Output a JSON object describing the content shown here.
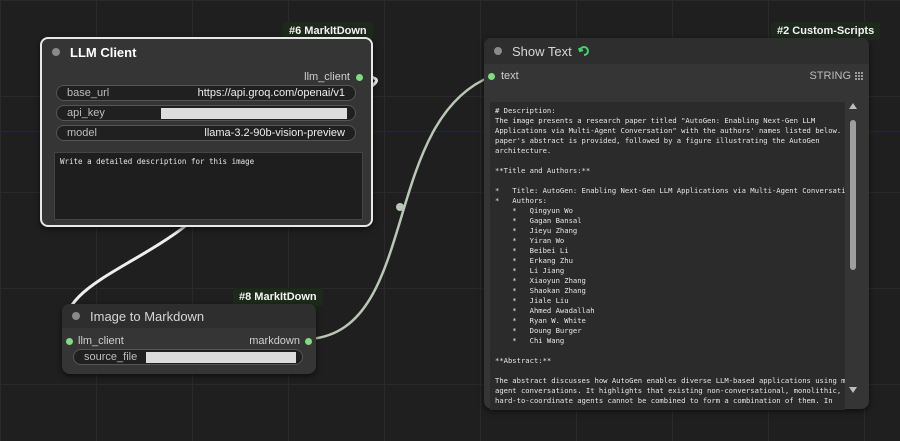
{
  "nodes": {
    "llm_client": {
      "badge": "#6 MarkItDown",
      "title": "LLM Client",
      "output": "llm_client",
      "base_url_label": "base_url",
      "base_url_value": "https://api.groq.com/openai/v1",
      "api_key_label": "api_key",
      "model_label": "model",
      "model_value": "llama-3.2-90b-vision-preview",
      "prompt": "Write a detailed description for this image"
    },
    "image_to_markdown": {
      "badge": "#8 MarkItDown",
      "title": "Image to Markdown",
      "input": "llm_client",
      "output": "markdown",
      "source_file_label": "source_file"
    },
    "show_text": {
      "badge": "#2 Custom-Scripts",
      "title": "Show Text",
      "input": "text",
      "type": "STRING",
      "content": "# Description:\nThe image presents a research paper titled \"AutoGen: Enabling Next-Gen LLM\nApplications via Multi-Agent Conversation\" with the authors' names listed below. The\npaper's abstract is provided, followed by a figure illustrating the AutoGen\narchitecture.\n\n**Title and Authors:**\n\n*   Title: AutoGen: Enabling Next-Gen LLM Applications via Multi-Agent Conversation\n*   Authors:\n    *   Qingyun Wo\n    *   Gagan Bansal\n    *   Jieyu Zhang\n    *   Yiran Wo\n    *   Beibei Li\n    *   Erkang Zhu\n    *   Li Jiang\n    *   Xiaoyun Zhang\n    *   Shaokan Zhang\n    *   Jiale Liu\n    *   Ahmed Awadallah\n    *   Ryan W. White\n    *   Doung Burger\n    *   Chi Wang\n\n**Abstract:**\n\nThe abstract discusses how AutoGen enables diverse LLM-based applications using multi-\nagent conversations. It highlights that existing non-conversational, monolithic, and\nhard-to-coordinate agents cannot be combined to form a combination of them. In"
    }
  },
  "icons": {
    "refresh": "refresh-icon",
    "scroll_up": "up-arrow-icon",
    "scroll_down": "down-arrow-icon",
    "grid": "grid-icon"
  },
  "colors": {
    "port": "#7dde7d",
    "link": "#b9c8b4",
    "badge_bg": "#1d2a1b"
  }
}
